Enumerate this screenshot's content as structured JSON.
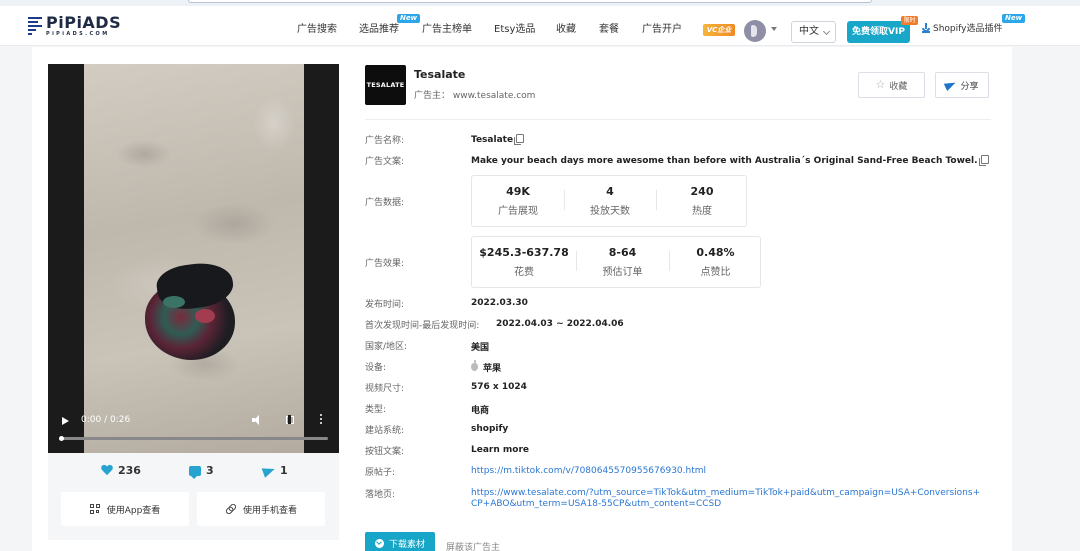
{
  "nav": {
    "logo_text": "PiPiADS",
    "logo_sub": "PiPiADS.COM",
    "items": [
      "广告搜索",
      "选品推荐",
      "广告主榜单",
      "Etsy选品",
      "收藏",
      "套餐",
      "广告开户"
    ],
    "new_badge": "New",
    "vip_logo": "VC企业",
    "language": "中文",
    "vip_button": "免费领取VIP",
    "hot_badge": "限时",
    "plugin": "Shopify选品插件",
    "plugin_badge": "New"
  },
  "video": {
    "time": "0:00 / 0:26",
    "progress": 0
  },
  "stats": {
    "likes": "236",
    "comments": "3",
    "shares": "1"
  },
  "buttons": {
    "app_view": "使用App查看",
    "phone_view": "使用手机查看",
    "favorite": "收藏",
    "share": "分享",
    "download": "下载素材",
    "block": "屏蔽该广告主"
  },
  "advertiser": {
    "logo_text": "TESALATE",
    "name": "Tesalate",
    "label": "广告主：",
    "site": "www.tesalate.com"
  },
  "details": {
    "ad_name_label": "广告名称:",
    "ad_name": "Tesalate",
    "ad_copy_label": "广告文案:",
    "ad_copy": "Make your beach days more awesome than before with Australia´s Original Sand-Free Beach Towel.",
    "ad_data_label": "广告数据:",
    "ad_data": [
      {
        "value": "49K",
        "label": "广告展现"
      },
      {
        "value": "4",
        "label": "投放天数"
      },
      {
        "value": "240",
        "label": "热度"
      }
    ],
    "ad_effect_label": "广告效果:",
    "ad_effect": [
      {
        "value": "$245.3-637.78",
        "label": "花费"
      },
      {
        "value": "8-64",
        "label": "预估订单"
      },
      {
        "value": "0.48%",
        "label": "点赞比"
      }
    ],
    "publish_label": "发布时间:",
    "publish": "2022.03.30",
    "seen_label": "首次发现时间-最后发现时间:",
    "seen": "2022.04.03 ~ 2022.04.06",
    "country_label": "国家/地区:",
    "country": "美国",
    "device_label": "设备:",
    "device": "苹果",
    "video_size_label": "视频尺寸:",
    "video_size": "576 x 1024",
    "type_label": "类型:",
    "type": "电商",
    "platform_label": "建站系统:",
    "platform": "shopify",
    "cta_label": "按钮文案:",
    "cta": "Learn more",
    "post_label": "原帖子:",
    "post_url": "https://m.tiktok.com/v/7080645570955676930.html",
    "landing_label": "落地页:",
    "landing_url_1": "https://www.tesalate.com/?utm_source=TikTok&utm_medium=TikTok+paid&utm_campaign=USA+Conversions+",
    "landing_url_2": "CP+ABO&utm_term=USA18-55CP&utm_content=CCSD"
  }
}
